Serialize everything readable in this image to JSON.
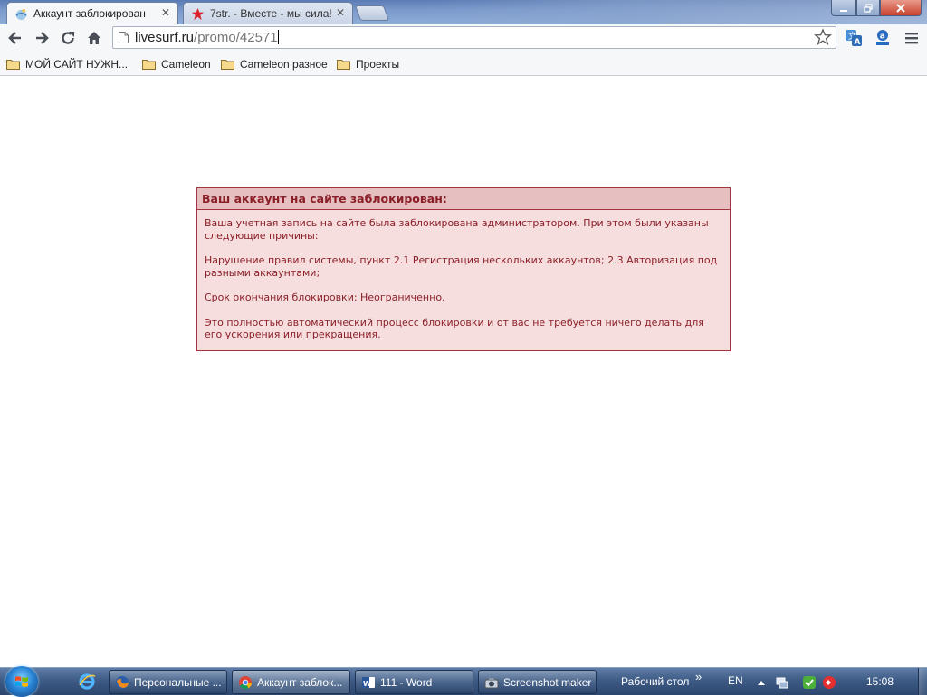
{
  "tabs": [
    {
      "title": "Аккаунт заблокирован",
      "close": "✕",
      "favicon": "livesurf-favicon-icon"
    },
    {
      "title": "7str. - Вместе - мы сила!",
      "close": "✕",
      "favicon": "red-star-icon"
    }
  ],
  "address": {
    "host": "livesurf.ru",
    "path": "/promo/42571"
  },
  "bookmarks": [
    {
      "label": "МОЙ САЙТ НУЖН..."
    },
    {
      "label": "Cameleon"
    },
    {
      "label": "Cameleon разное"
    },
    {
      "label": "Проекты"
    }
  ],
  "notice": {
    "heading": "Ваш аккаунт на сайте заблокирован:",
    "paragraphs": [
      "Ваша учетная запись на сайте была заблокирована администратором. При этом были указаны следующие причины:",
      "Нарушение правил системы, пункт 2.1 Регистрация нескольких аккаунтов; 2.3 Авторизация под разными аккаунтами;",
      "Срок окончания блокировки: Неограниченно.",
      "Это полностью автоматический процесс блокировки и от вас не требуется ничего делать для его ускорения или прекращения."
    ]
  },
  "taskbar": {
    "tasks": [
      {
        "label": "Персональные ...",
        "icon": "firefox-icon"
      },
      {
        "label": "Аккаунт заблок...",
        "icon": "chrome-icon"
      },
      {
        "label": "111 - Word",
        "icon": "word-icon"
      },
      {
        "label": "Screenshot maker",
        "icon": "screenshot-maker-icon"
      }
    ],
    "desktop_toolbar": "Рабочий стол",
    "chevron": "»",
    "language": "EN",
    "clock": "15:08"
  },
  "colors": {
    "notice_border": "#a3343c",
    "notice_bg": "#f6dedf",
    "notice_head_bg": "#e6bfc1",
    "notice_text": "#8b1f27"
  }
}
